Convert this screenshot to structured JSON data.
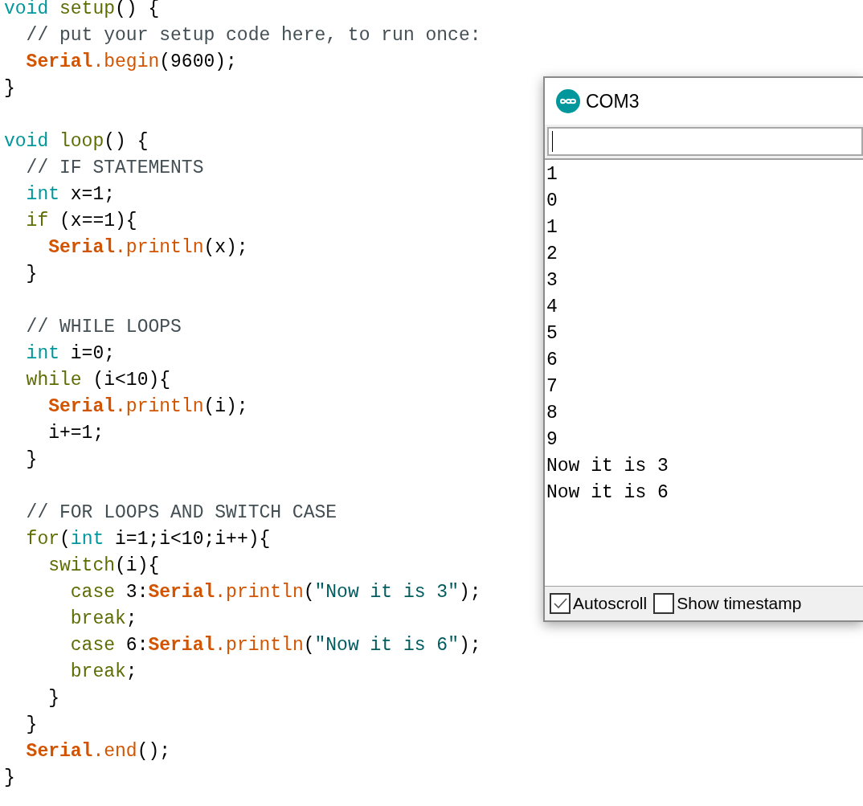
{
  "code": {
    "lines": [
      {
        "kind": "code",
        "tokens": [
          {
            "kind": "keyword",
            "text": "void "
          },
          {
            "kind": "function",
            "text": "setup"
          },
          {
            "kind": "plain",
            "text": "() {"
          }
        ]
      },
      {
        "kind": "code",
        "tokens": [
          {
            "kind": "comment",
            "text": "  // put your setup code here, to run once:"
          }
        ]
      },
      {
        "kind": "code",
        "tokens": [
          {
            "kind": "object",
            "text": "  Serial"
          },
          {
            "kind": "method",
            "text": ".begin"
          },
          {
            "kind": "plain",
            "text": "(9600);"
          }
        ]
      },
      {
        "kind": "code",
        "tokens": [
          {
            "kind": "plain",
            "text": "}"
          }
        ]
      },
      {
        "kind": "blank"
      },
      {
        "kind": "code",
        "tokens": [
          {
            "kind": "keyword",
            "text": "void "
          },
          {
            "kind": "function",
            "text": "loop"
          },
          {
            "kind": "plain",
            "text": "() {"
          }
        ]
      },
      {
        "kind": "code",
        "tokens": [
          {
            "kind": "comment",
            "text": "  // IF STATEMENTS"
          }
        ]
      },
      {
        "kind": "code",
        "tokens": [
          {
            "kind": "keyword",
            "text": "  int"
          },
          {
            "kind": "plain",
            "text": " x=1;"
          }
        ]
      },
      {
        "kind": "code",
        "tokens": [
          {
            "kind": "function",
            "text": "  if"
          },
          {
            "kind": "plain",
            "text": " (x==1){"
          }
        ]
      },
      {
        "kind": "code",
        "tokens": [
          {
            "kind": "object",
            "text": "    Serial"
          },
          {
            "kind": "method",
            "text": ".println"
          },
          {
            "kind": "plain",
            "text": "(x);"
          }
        ]
      },
      {
        "kind": "code",
        "tokens": [
          {
            "kind": "plain",
            "text": "  }"
          }
        ]
      },
      {
        "kind": "blank"
      },
      {
        "kind": "code",
        "tokens": [
          {
            "kind": "comment",
            "text": "  // WHILE LOOPS"
          }
        ]
      },
      {
        "kind": "code",
        "tokens": [
          {
            "kind": "keyword",
            "text": "  int"
          },
          {
            "kind": "plain",
            "text": " i=0;"
          }
        ]
      },
      {
        "kind": "code",
        "tokens": [
          {
            "kind": "function",
            "text": "  while"
          },
          {
            "kind": "plain",
            "text": " (i<10){"
          }
        ]
      },
      {
        "kind": "code",
        "tokens": [
          {
            "kind": "object",
            "text": "    Serial"
          },
          {
            "kind": "method",
            "text": ".println"
          },
          {
            "kind": "plain",
            "text": "(i);"
          }
        ]
      },
      {
        "kind": "code",
        "tokens": [
          {
            "kind": "plain",
            "text": "    i+=1;"
          }
        ]
      },
      {
        "kind": "code",
        "tokens": [
          {
            "kind": "plain",
            "text": "  }"
          }
        ]
      },
      {
        "kind": "blank"
      },
      {
        "kind": "code",
        "tokens": [
          {
            "kind": "comment",
            "text": "  // FOR LOOPS AND SWITCH CASE"
          }
        ]
      },
      {
        "kind": "code",
        "tokens": [
          {
            "kind": "function",
            "text": "  for"
          },
          {
            "kind": "plain",
            "text": "("
          },
          {
            "kind": "keyword",
            "text": "int"
          },
          {
            "kind": "plain",
            "text": " i=1;i<10;i++){"
          }
        ]
      },
      {
        "kind": "code",
        "tokens": [
          {
            "kind": "function",
            "text": "    switch"
          },
          {
            "kind": "plain",
            "text": "(i){"
          }
        ]
      },
      {
        "kind": "code",
        "tokens": [
          {
            "kind": "function",
            "text": "      case"
          },
          {
            "kind": "plain",
            "text": " 3:"
          },
          {
            "kind": "object",
            "text": "Serial"
          },
          {
            "kind": "method",
            "text": ".println"
          },
          {
            "kind": "plain",
            "text": "("
          },
          {
            "kind": "string",
            "text": "\"Now it is 3\""
          },
          {
            "kind": "plain",
            "text": ");"
          }
        ]
      },
      {
        "kind": "code",
        "tokens": [
          {
            "kind": "function",
            "text": "      break"
          },
          {
            "kind": "plain",
            "text": ";"
          }
        ]
      },
      {
        "kind": "code",
        "tokens": [
          {
            "kind": "function",
            "text": "      case"
          },
          {
            "kind": "plain",
            "text": " 6:"
          },
          {
            "kind": "object",
            "text": "Serial"
          },
          {
            "kind": "method",
            "text": ".println"
          },
          {
            "kind": "plain",
            "text": "("
          },
          {
            "kind": "string",
            "text": "\"Now it is 6\""
          },
          {
            "kind": "plain",
            "text": ");"
          }
        ]
      },
      {
        "kind": "code",
        "tokens": [
          {
            "kind": "function",
            "text": "      break"
          },
          {
            "kind": "plain",
            "text": ";"
          }
        ]
      },
      {
        "kind": "code",
        "tokens": [
          {
            "kind": "plain",
            "text": "    }"
          }
        ]
      },
      {
        "kind": "code",
        "tokens": [
          {
            "kind": "plain",
            "text": "  }"
          }
        ]
      },
      {
        "kind": "code",
        "tokens": [
          {
            "kind": "object",
            "text": "  Serial"
          },
          {
            "kind": "method",
            "text": ".end"
          },
          {
            "kind": "plain",
            "text": "();"
          }
        ]
      },
      {
        "kind": "code",
        "tokens": [
          {
            "kind": "plain",
            "text": "}"
          }
        ]
      }
    ]
  },
  "serial_monitor": {
    "title": "COM3",
    "output": [
      "1",
      "0",
      "1",
      "2",
      "3",
      "4",
      "5",
      "6",
      "7",
      "8",
      "9",
      "Now it is 3",
      "Now it is 6"
    ],
    "options": [
      {
        "label": "Autoscroll",
        "checked": true
      },
      {
        "label": "Show timestamp",
        "checked": false
      }
    ]
  }
}
